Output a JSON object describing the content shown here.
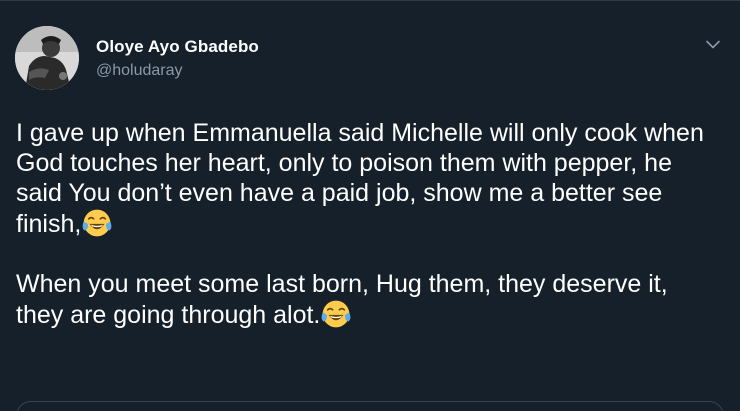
{
  "tweet": {
    "author": {
      "display_name": "Oloye Ayo Gbadebo",
      "username": "@holudaray"
    },
    "paragraphs": [
      {
        "text": "I gave up when Emmanuella said Michelle will only cook when God touches her heart, only to poison them with pepper, he said You don’t even have a paid job, show me a better see finish,",
        "emoji": "face-with-tears-of-joy"
      },
      {
        "text": "When you meet some last born, Hug them, they deserve it, they are going through alot.",
        "emoji": "face-with-tears-of-joy"
      }
    ],
    "menu_icon": "chevron-down-icon"
  },
  "colors": {
    "background": "#15202b",
    "primary_text": "#ffffff",
    "secondary_text": "#8899a6",
    "border": "#38444d"
  }
}
